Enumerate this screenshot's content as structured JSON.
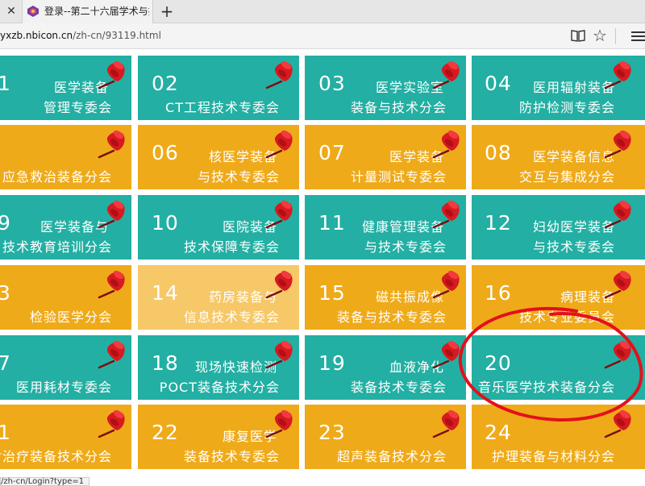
{
  "browser": {
    "tab_title": "登录--第二十六届学术与技",
    "tab_close_symbol": "✕",
    "newtab_symbol": "+",
    "url_host": "yxzb.nbicon.cn",
    "url_path": "/zh-cn/93119.html",
    "star_symbol": "☆",
    "status_url": "/zh-cn/Login?type=1"
  },
  "colors": {
    "teal": "#23afa3",
    "gold": "#efaa1a",
    "light": "#f6c867",
    "annotation_red": "#e3101c"
  },
  "tiles": [
    {
      "num": "1",
      "line1": "医学装备",
      "line2": "管理专委会"
    },
    {
      "num": "02",
      "line1": "",
      "line2": "CT工程技术专委会"
    },
    {
      "num": "03",
      "line1": "医学实验室",
      "line2": "装备与技术分会"
    },
    {
      "num": "04",
      "line1": "医用辐射装备",
      "line2": "防护检测专委会"
    },
    {
      "num": "",
      "line1": "",
      "line2": "应急救治装备分会"
    },
    {
      "num": "06",
      "line1": "核医学装备",
      "line2": "与技术专委会"
    },
    {
      "num": "07",
      "line1": "医学装备",
      "line2": "计量测试专委会"
    },
    {
      "num": "08",
      "line1": "医学装备信息",
      "line2": "交互与集成分会"
    },
    {
      "num": "9",
      "line1": "医学装备与",
      "line2": "技术教育培训分会"
    },
    {
      "num": "10",
      "line1": "医院装备",
      "line2": "技术保障专委会"
    },
    {
      "num": "11",
      "line1": "健康管理装备",
      "line2": "与技术专委会"
    },
    {
      "num": "12",
      "line1": "妇幼医学装备",
      "line2": "与技术专委会"
    },
    {
      "num": "3",
      "line1": "",
      "line2": "检验医学分会"
    },
    {
      "num": "14",
      "line1": "药房装备与",
      "line2": "信息技术专委会"
    },
    {
      "num": "15",
      "line1": "磁共振成像",
      "line2": "装备与技术专委会"
    },
    {
      "num": "16",
      "line1": "病理装备",
      "line2": "技术专业委员会"
    },
    {
      "num": "7",
      "line1": "",
      "line2": "医用耗材专委会"
    },
    {
      "num": "18",
      "line1": "现场快速检测",
      "line2": "POCT装备技术分会"
    },
    {
      "num": "19",
      "line1": "血液净化",
      "line2": "装备技术专委会"
    },
    {
      "num": "20",
      "line1": "",
      "line2": "音乐医学技术装备分会"
    },
    {
      "num": "1",
      "line1": "",
      "line2": "放射治疗装备技术分会"
    },
    {
      "num": "22",
      "line1": "康复医学",
      "line2": "装备技术专委会"
    },
    {
      "num": "23",
      "line1": "",
      "line2": "超声装备技术分会"
    },
    {
      "num": "24",
      "line1": "",
      "line2": "护理装备与材料分会"
    }
  ]
}
